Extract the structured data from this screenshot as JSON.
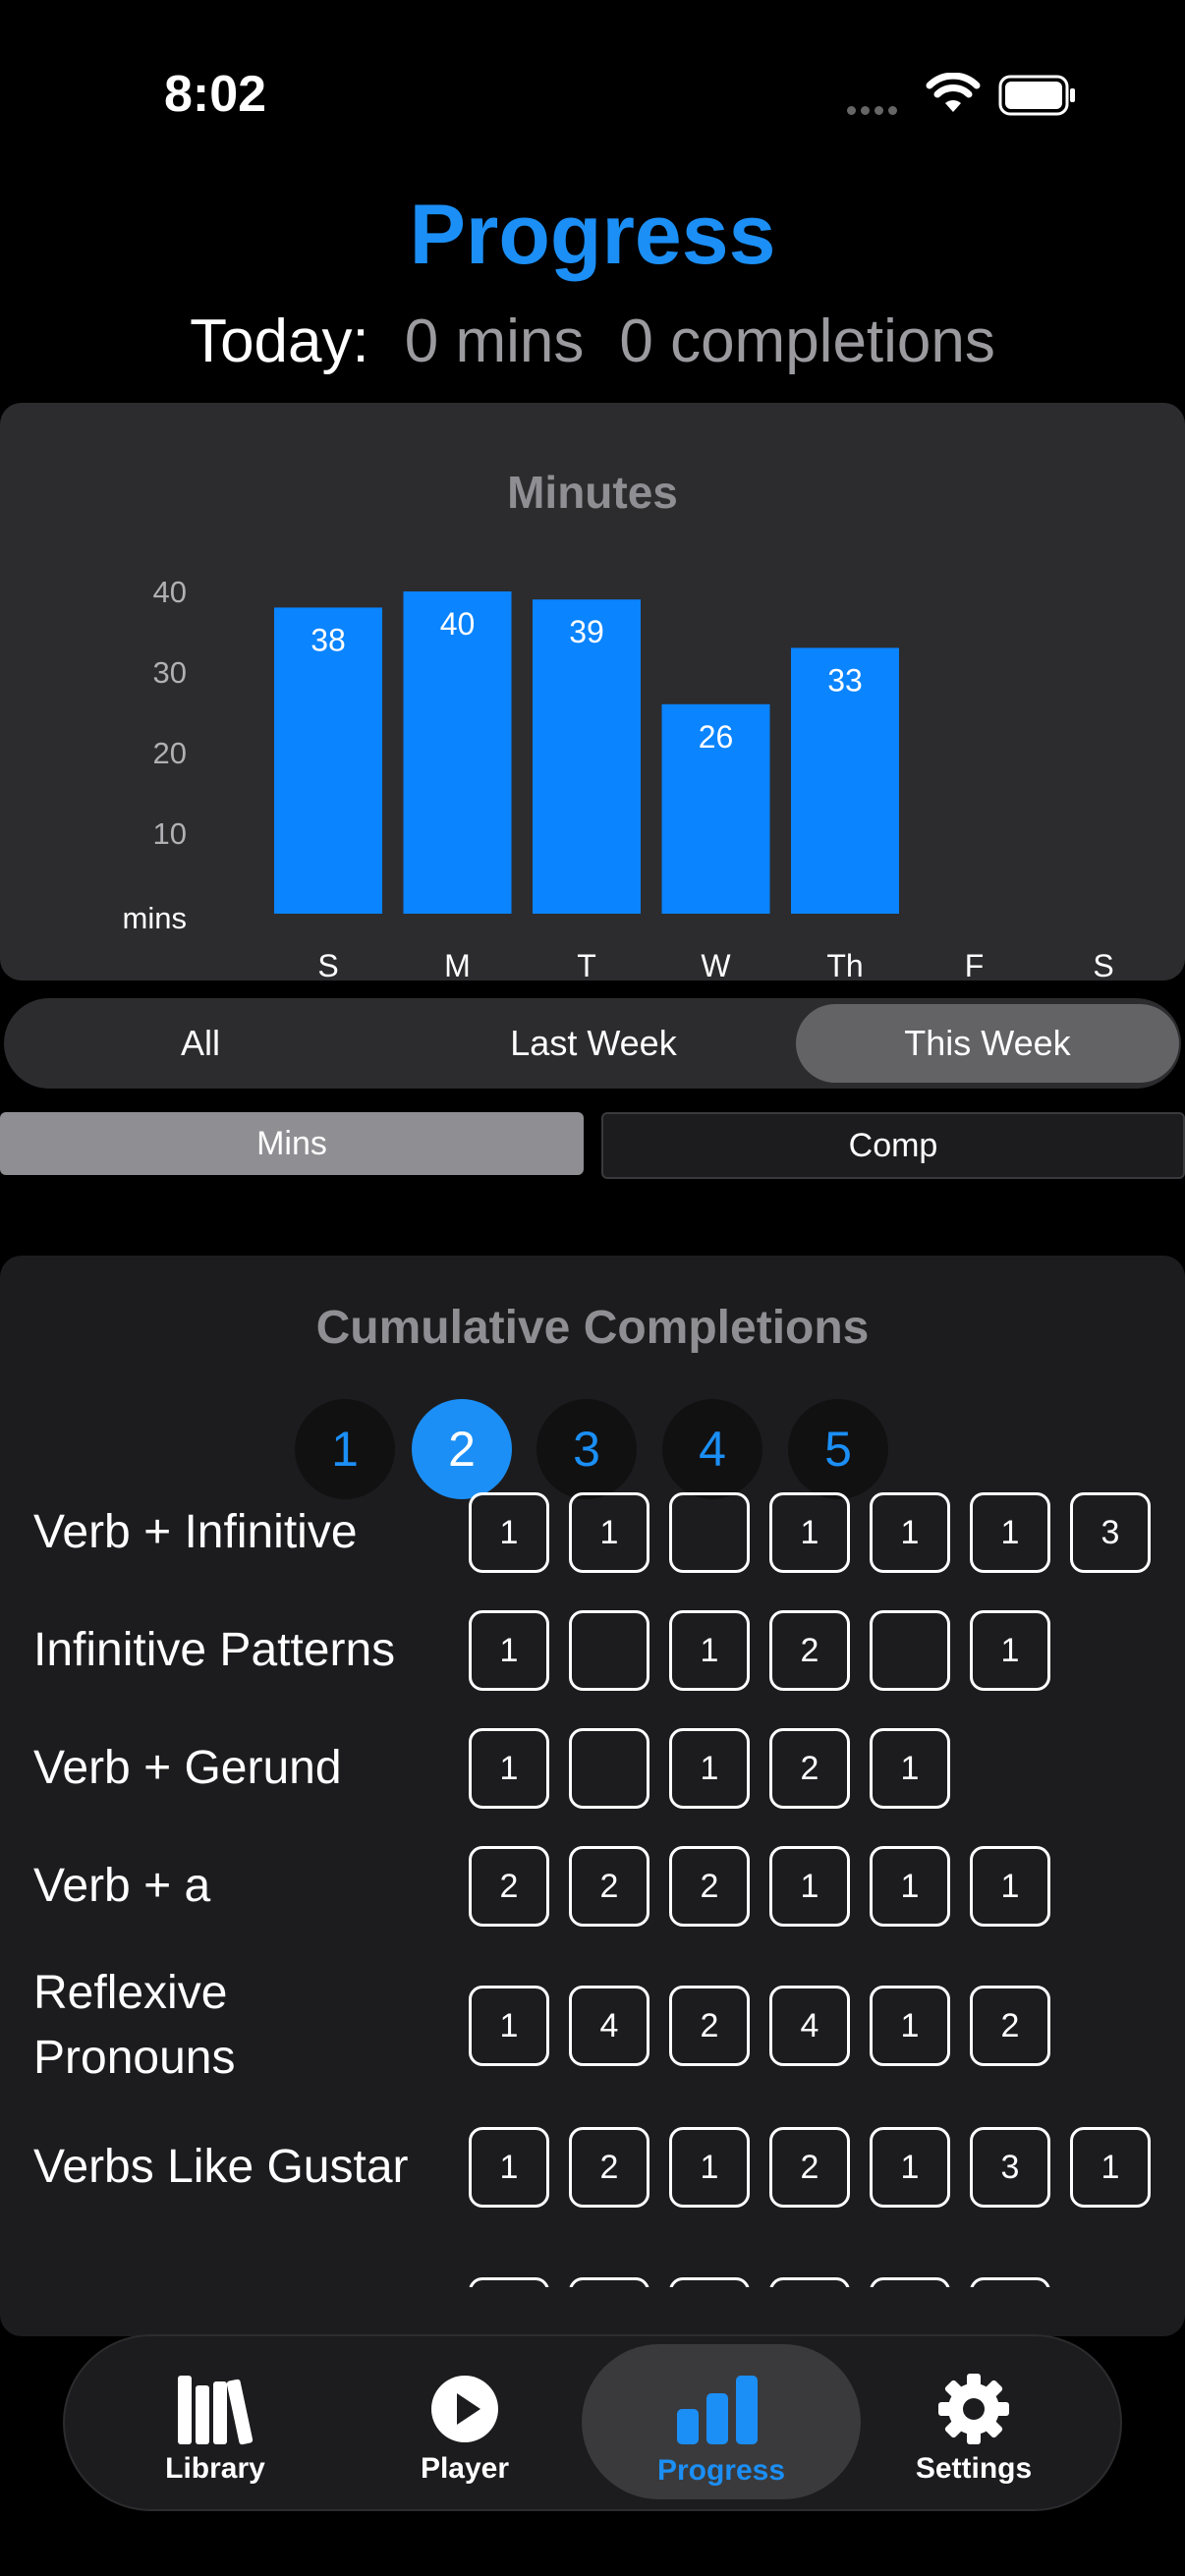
{
  "status": {
    "time": "8:02"
  },
  "header": {
    "title": "Progress",
    "today_label": "Today:",
    "today_mins": "0 mins",
    "today_completions": "0 completions"
  },
  "chart_data": {
    "type": "bar",
    "title": "Minutes",
    "ylabel": "mins",
    "categories": [
      "S",
      "M",
      "T",
      "W",
      "Th",
      "F",
      "S"
    ],
    "values": [
      38,
      40,
      39,
      26,
      33,
      null,
      null
    ],
    "yticks": [
      10,
      20,
      30,
      40
    ],
    "ylim": [
      0,
      48
    ],
    "color": "#0a84ff",
    "grid": false
  },
  "range_tabs": [
    "All",
    "Last Week",
    "This Week"
  ],
  "range_selected": "This Week",
  "metric_toggle": {
    "mins": "Mins",
    "comp": "Comp"
  },
  "cumulative": {
    "title": "Cumulative Completions",
    "levels": [
      "1",
      "2",
      "3",
      "4",
      "5"
    ],
    "selected_level": "2",
    "rows": [
      {
        "label": "Verb + Infinitive",
        "boxes": [
          "1",
          "1",
          "",
          "1",
          "1",
          "1",
          "3"
        ]
      },
      {
        "label": "Infinitive Patterns",
        "boxes": [
          "1",
          "",
          "1",
          "2",
          "",
          "1"
        ]
      },
      {
        "label": "Verb + Gerund",
        "boxes": [
          "1",
          "",
          "1",
          "2",
          "1"
        ]
      },
      {
        "label": "Verb + a",
        "boxes": [
          "2",
          "2",
          "2",
          "1",
          "1",
          "1"
        ]
      },
      {
        "label": "Reflexive\nPronouns",
        "boxes": [
          "1",
          "4",
          "2",
          "4",
          "1",
          "2"
        ]
      },
      {
        "label": "Verbs Like Gustar",
        "boxes": [
          "1",
          "2",
          "1",
          "2",
          "1",
          "3",
          "1"
        ]
      }
    ]
  },
  "tabbar": [
    {
      "label": "Library",
      "icon": "library-icon"
    },
    {
      "label": "Player",
      "icon": "play-icon"
    },
    {
      "label": "Progress",
      "icon": "bar-chart-icon"
    },
    {
      "label": "Settings",
      "icon": "gear-icon"
    }
  ],
  "colors": {
    "accent": "#1b8ff6",
    "card": "#2c2c2e",
    "background": "#000000"
  }
}
